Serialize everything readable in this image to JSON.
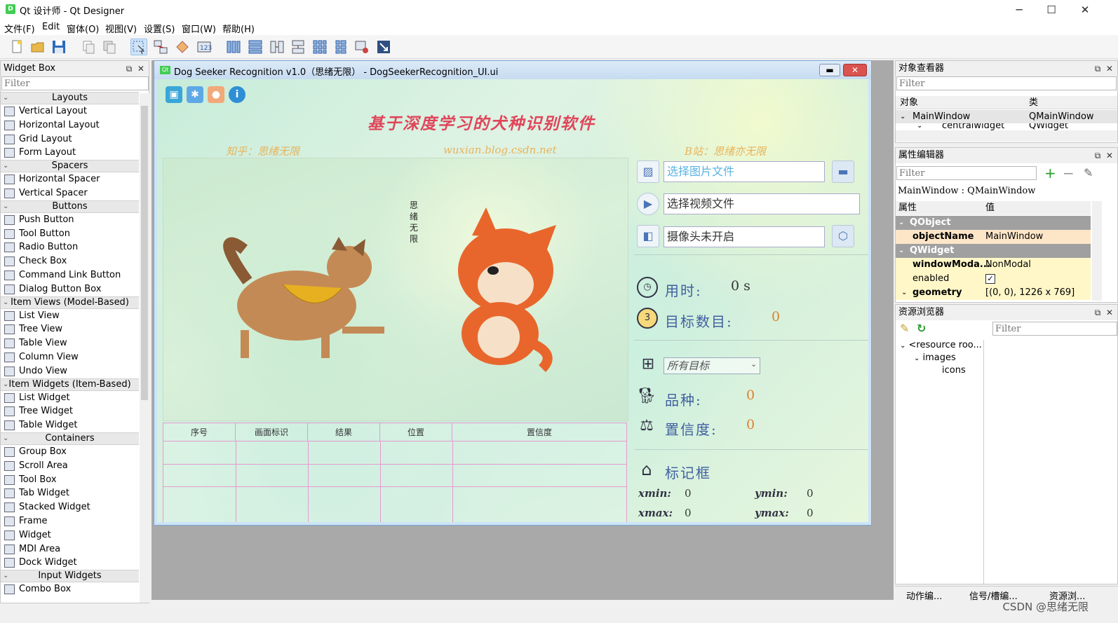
{
  "window": {
    "title": "Qt 设计师 - Qt Designer",
    "app_icon": "D",
    "minimize": "─",
    "maximize": "☐",
    "close": "✕"
  },
  "menu": [
    "文件(F)",
    "Edit",
    "窗体(O)",
    "视图(V)",
    "设置(S)",
    "窗口(W)",
    "帮助(H)"
  ],
  "toolbar": {
    "icons": [
      "new-file-icon",
      "open-folder-icon",
      "save-icon",
      "copy-icon",
      "paste-icon",
      "edit-widgets-icon",
      "edit-signals-icon",
      "edit-buddies-icon",
      "edit-tab-order-icon",
      "layout-horizontal-icon",
      "layout-vertical-icon",
      "layout-horizontal-splitter-icon",
      "layout-vertical-splitter-icon",
      "layout-grid-icon",
      "layout-form-icon",
      "break-layout-icon",
      "adjust-size-icon"
    ]
  },
  "widget_box": {
    "title": "Widget Box",
    "filter_placeholder": "Filter",
    "categories": [
      {
        "name": "Layouts",
        "items": [
          "Vertical Layout",
          "Horizontal Layout",
          "Grid Layout",
          "Form Layout"
        ]
      },
      {
        "name": "Spacers",
        "items": [
          "Horizontal Spacer",
          "Vertical Spacer"
        ]
      },
      {
        "name": "Buttons",
        "items": [
          "Push Button",
          "Tool Button",
          "Radio Button",
          "Check Box",
          "Command Link Button",
          "Dialog Button Box"
        ]
      },
      {
        "name": "Item Views (Model-Based)",
        "items": [
          "List View",
          "Tree View",
          "Table View",
          "Column View",
          "Undo View"
        ]
      },
      {
        "name": "Item Widgets (Item-Based)",
        "items": [
          "List Widget",
          "Tree Widget",
          "Table Widget"
        ]
      },
      {
        "name": "Containers",
        "items": [
          "Group Box",
          "Scroll Area",
          "Tool Box",
          "Tab Widget",
          "Stacked Widget",
          "Frame",
          "Widget",
          "MDI Area",
          "Dock Widget"
        ]
      },
      {
        "name": "Input Widgets",
        "items": [
          "Combo Box"
        ]
      }
    ]
  },
  "form": {
    "window_title": "Dog Seeker Recognition v1.0（思绪无限） - DogSeekerRecognition_UI.ui",
    "qt_badge": "Qt",
    "main_title": "基于深度学习的犬种识别软件",
    "credits": {
      "zhihu": "知乎：思绪无限",
      "blog": "wuxian.blog.csdn.net",
      "bilibili": "B站：思绪亦无限"
    },
    "vertical_signature": [
      "思",
      "绪",
      "无",
      "限"
    ],
    "table_headers": [
      "序号",
      "画面标识",
      "结果",
      "位置",
      "置信度"
    ],
    "inputs": {
      "image": "选择图片文件",
      "video": "选择视频文件",
      "camera": "摄像头未开启"
    },
    "stats": {
      "time_label": "用时:",
      "time_value": "0 s",
      "count_label": "目标数目:",
      "count_value": "0",
      "target_select": "所有目标",
      "breed_label": "品种:",
      "breed_value": "0",
      "confidence_label": "置信度:",
      "confidence_value": "0",
      "bbox_label": "标记框"
    },
    "coords": {
      "xmin_label": "xmin:",
      "xmin": "0",
      "ymin_label": "ymin:",
      "ymin": "0",
      "xmax_label": "xmax:",
      "xmax": "0",
      "ymax_label": "ymax:",
      "ymax": "0"
    },
    "colors": {
      "title": "#e0455a",
      "credit": "#e8b35a",
      "value": "#e0802e"
    }
  },
  "object_inspector": {
    "title": "对象查看器",
    "filter_placeholder": "Filter",
    "col_object": "对象",
    "col_class": "类",
    "rows": [
      {
        "object": "MainWindow",
        "class": "QMainWindow"
      },
      {
        "object": "centralwidget",
        "class": "QWidget"
      }
    ]
  },
  "property_editor": {
    "title": "属性编辑器",
    "filter_placeholder": "Filter",
    "context": "MainWindow : QMainWindow",
    "col_property": "属性",
    "col_value": "值",
    "groups": [
      {
        "name": "QObject"
      },
      {
        "key": "objectName",
        "value": "MainWindow"
      },
      {
        "name": "QWidget"
      },
      {
        "key": "windowModa...",
        "value": "NonModal"
      },
      {
        "key": "enabled",
        "value": "✓"
      },
      {
        "key": "geometry",
        "value": "[(0, 0), 1226 x 769]"
      }
    ]
  },
  "resource_browser": {
    "title": "资源浏览器",
    "filter_placeholder": "Filter",
    "tree": [
      "<resource roo...",
      "images",
      "icons"
    ]
  },
  "bottom_tabs": [
    "动作编...",
    "信号/槽编...",
    "资源浏..."
  ],
  "watermark": "CSDN @思绪无限"
}
